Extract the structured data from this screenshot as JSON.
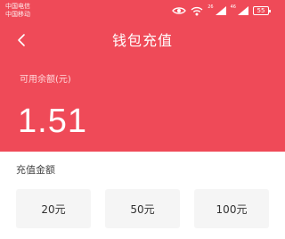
{
  "status_bar": {
    "carrier_1": "中国电信",
    "carrier_2": "中国移动",
    "network_1": "26",
    "network_2": "46",
    "battery": "55"
  },
  "nav": {
    "back_icon": "chevron-left-icon",
    "title": "钱包充值"
  },
  "balance": {
    "label": "可用余额(元)",
    "value": "1.51"
  },
  "recharge": {
    "section_label": "充值金额",
    "options": [
      "20元",
      "50元",
      "100元"
    ]
  },
  "colors": {
    "header_red": "#ef4a58",
    "panel_background": "#ffffff",
    "option_background": "#f5f5f5",
    "text_dark": "#333333"
  }
}
